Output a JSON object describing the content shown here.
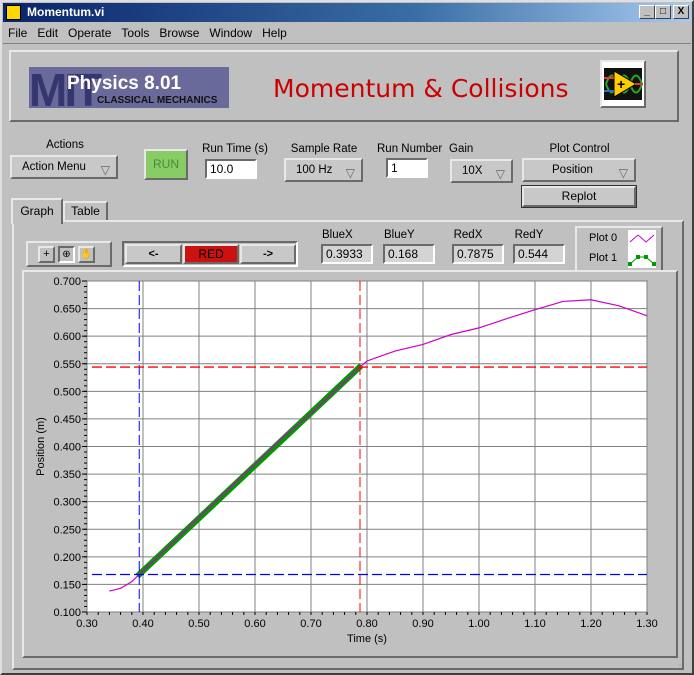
{
  "window": {
    "title": "Momentum.vi",
    "minimize": "_",
    "maximize": "□",
    "close": "X"
  },
  "menu": [
    "File",
    "Edit",
    "Operate",
    "Tools",
    "Browse",
    "Window",
    "Help"
  ],
  "banner": {
    "logo_big": "MIT",
    "logo_title": "Physics 8.01",
    "logo_sub": "CLASSICAL MECHANICS",
    "title": "Momentum & Collisions",
    "title_color": "#cc0000"
  },
  "controls": {
    "actions": {
      "label": "Actions",
      "value": "Action Menu"
    },
    "run": {
      "label": "RUN",
      "color": "#88cc66"
    },
    "run_time": {
      "label": "Run Time (s)",
      "value": "10.0"
    },
    "sample_rate": {
      "label": "Sample Rate",
      "value": "100 Hz"
    },
    "run_number": {
      "label": "Run Number",
      "value": "1"
    },
    "gain": {
      "label": "Gain",
      "value": "10X"
    },
    "plot_control": {
      "label": "Plot Control",
      "value": "Position"
    },
    "replot": "Replot"
  },
  "tabs": [
    {
      "label": "Graph",
      "active": true
    },
    {
      "label": "Table",
      "active": false
    }
  ],
  "graph_toolbar": {
    "tools": [
      "crosshair-icon",
      "zoom-icon",
      "hand-icon"
    ],
    "prev": "<-",
    "cursor": "RED",
    "next": "->"
  },
  "cursors": {
    "bluex": {
      "label": "BlueX",
      "value": "0.3933"
    },
    "bluey": {
      "label": "BlueY",
      "value": "0.168"
    },
    "redx": {
      "label": "RedX",
      "value": "0.7875"
    },
    "redy": {
      "label": "RedY",
      "value": "0.544"
    }
  },
  "legend": [
    "Plot 0",
    "Plot 1"
  ],
  "chart_data": {
    "type": "line",
    "xlabel": "Time (s)",
    "ylabel": "Position (m)",
    "xlim": [
      0.3,
      1.3
    ],
    "ylim": [
      0.1,
      0.7
    ],
    "xticks": [
      "0.30",
      "0.40",
      "0.50",
      "0.60",
      "0.70",
      "0.80",
      "0.90",
      "1.00",
      "1.10",
      "1.20",
      "1.30"
    ],
    "yticks": [
      "0.100",
      "0.150",
      "0.200",
      "0.250",
      "0.300",
      "0.350",
      "0.400",
      "0.450",
      "0.500",
      "0.550",
      "0.600",
      "0.650",
      "0.700"
    ],
    "grid": true,
    "series": [
      {
        "name": "Plot 0",
        "color": "#cc00cc",
        "x": [
          0.34,
          0.36,
          0.38,
          0.3933,
          0.45,
          0.5,
          0.55,
          0.6,
          0.65,
          0.7,
          0.75,
          0.7875,
          0.8,
          0.85,
          0.9,
          0.95,
          1.0,
          1.05,
          1.1,
          1.15,
          1.2,
          1.25,
          1.3
        ],
        "y": [
          0.138,
          0.143,
          0.155,
          0.168,
          0.223,
          0.272,
          0.32,
          0.368,
          0.417,
          0.46,
          0.508,
          0.544,
          0.555,
          0.573,
          0.585,
          0.603,
          0.615,
          0.632,
          0.648,
          0.663,
          0.666,
          0.655,
          0.637
        ]
      },
      {
        "name": "Plot 1",
        "color": "#009900",
        "x": [
          0.39,
          0.79
        ],
        "y": [
          0.165,
          0.547
        ]
      }
    ],
    "cursors": [
      {
        "color": "#0000ff",
        "x": 0.3933,
        "y": 0.168
      },
      {
        "color": "#ff0000",
        "x": 0.7875,
        "y": 0.544
      }
    ]
  }
}
